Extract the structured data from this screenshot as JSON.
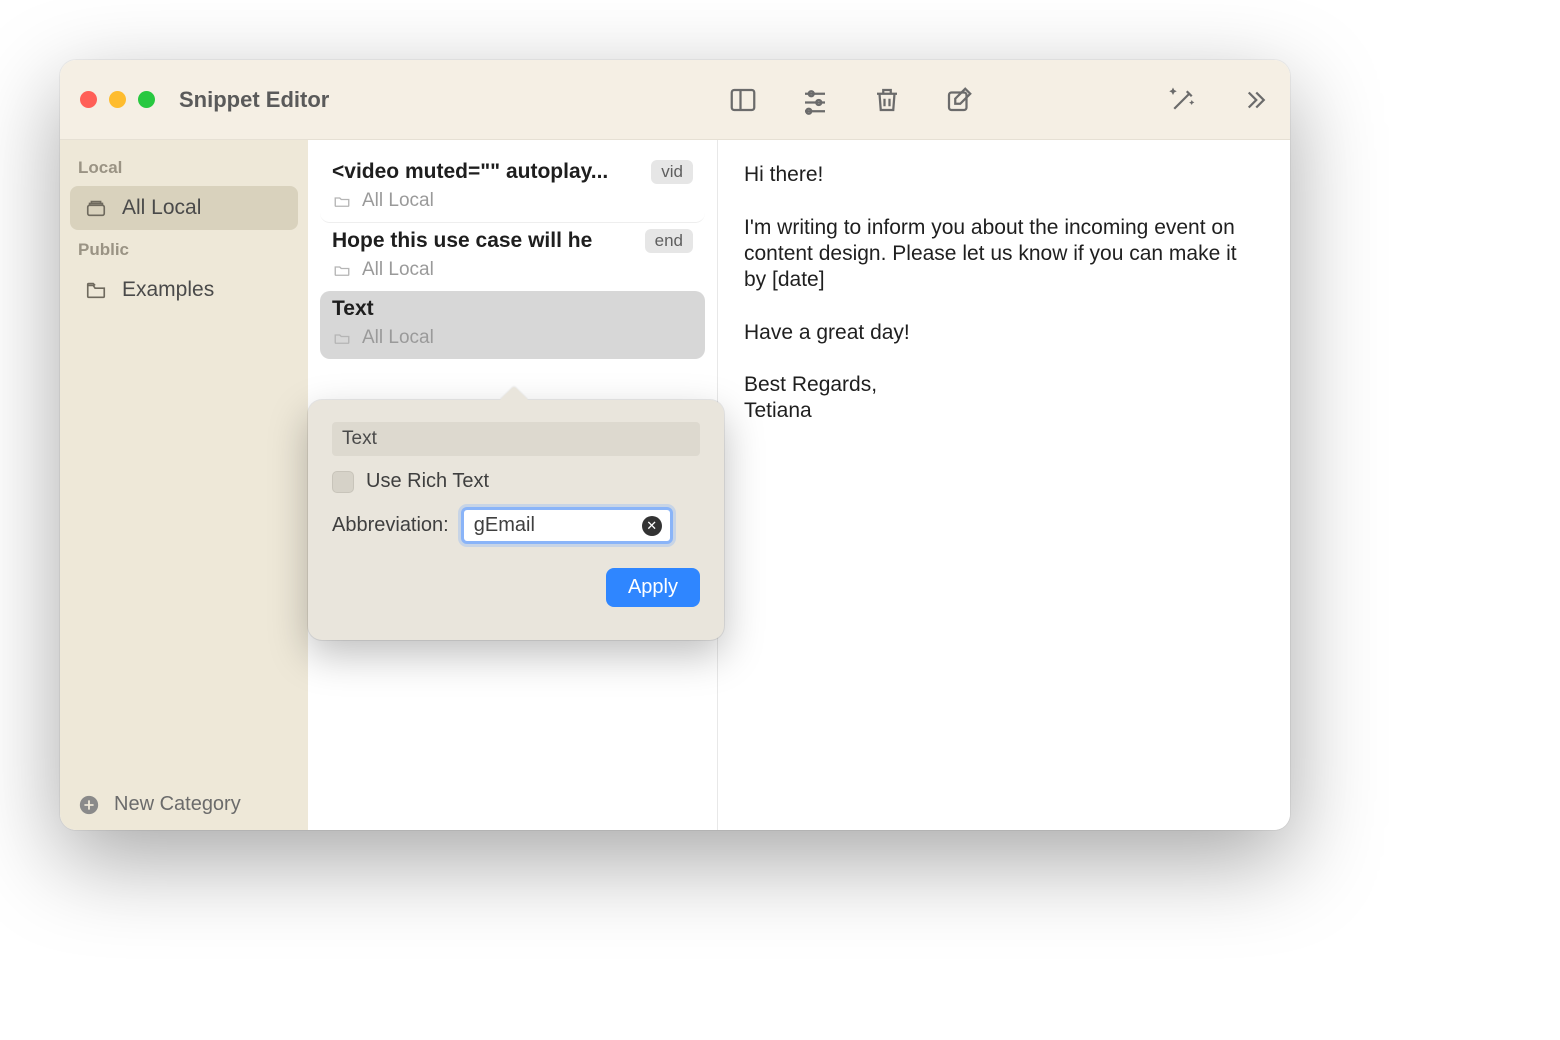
{
  "window": {
    "title": "Snippet Editor"
  },
  "sidebar": {
    "sections": [
      {
        "label": "Local",
        "items": [
          {
            "label": "All Local",
            "selected": true
          }
        ]
      },
      {
        "label": "Public",
        "items": [
          {
            "label": "Examples",
            "selected": false
          }
        ]
      }
    ],
    "footer": {
      "label": "New Category"
    }
  },
  "list": {
    "items": [
      {
        "title": "<video muted=\"\" autoplay...",
        "badge": "vid",
        "folder": "All Local",
        "selected": false
      },
      {
        "title": "Hope this use case will he",
        "badge": "end",
        "folder": "All Local",
        "selected": false
      },
      {
        "title": "Text",
        "badge": "",
        "folder": "All Local",
        "selected": true
      }
    ]
  },
  "popover": {
    "title_value": "Text",
    "rich_text_label": "Use Rich Text",
    "rich_text_checked": false,
    "abbrev_label": "Abbreviation:",
    "abbrev_value": "gEmail",
    "apply_label": "Apply"
  },
  "preview": {
    "text": "Hi there!\n\nI'm writing to inform you about the incoming event on content design. Please let us know if you can make it by [date]\n\nHave a great day!\n\nBest Regards,\nTetiana"
  }
}
